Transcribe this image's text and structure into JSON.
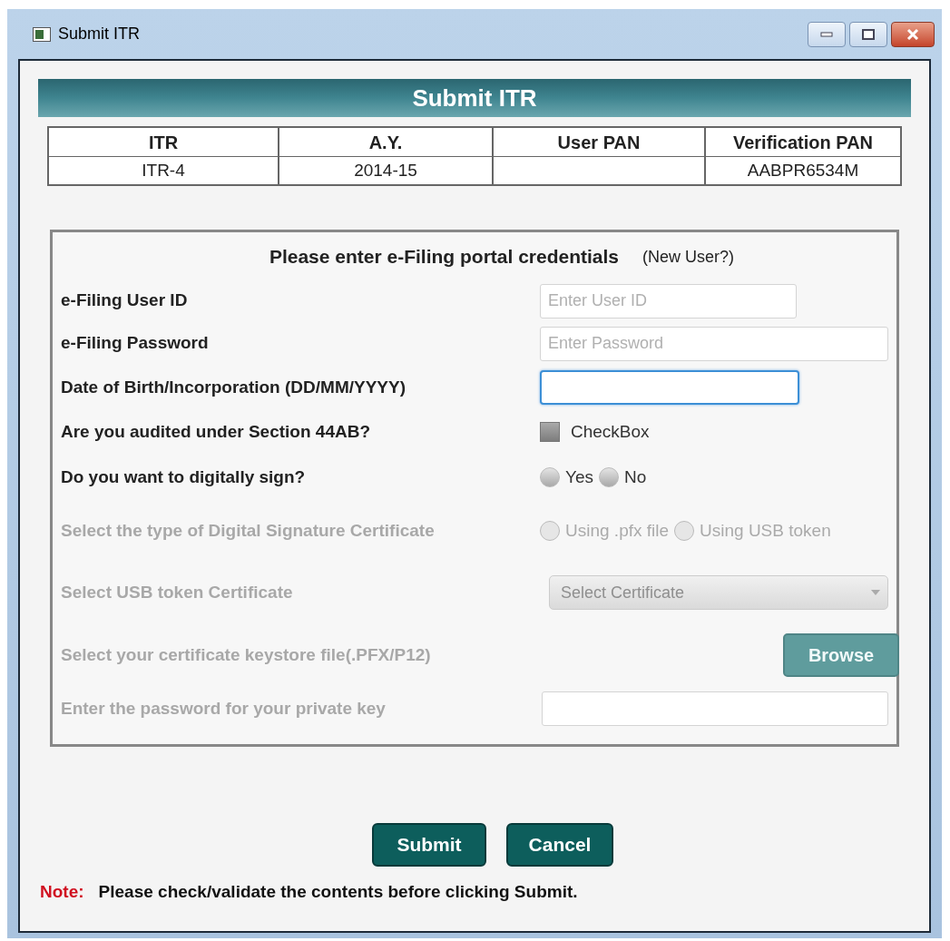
{
  "window": {
    "title": "Submit ITR"
  },
  "banner": "Submit ITR",
  "summary": {
    "columns": [
      "ITR",
      "A.Y.",
      "User PAN",
      "Verification PAN"
    ],
    "row": {
      "itr": "ITR-4",
      "ay": "2014-15",
      "verification_pan": "AABPR6534M"
    }
  },
  "form": {
    "heading": "Please enter e-Filing portal credentials",
    "link": "(New User?)",
    "rows": [
      {
        "kind": "text",
        "label": "e-Filing User ID",
        "placeholder": "Enter User ID",
        "disabled": false,
        "focused": false
      },
      {
        "kind": "text",
        "label": "e-Filing Password",
        "placeholder": "Enter Password",
        "disabled": false,
        "focused": false
      },
      {
        "kind": "text",
        "label": "Date of Birth/Incorporation (DD/MM/YYYY)",
        "disabled": false,
        "focused": true
      },
      {
        "kind": "checkbox",
        "label": "Are you audited under Section 44AB?",
        "option": "CheckBox",
        "checked": false,
        "disabled": false
      },
      {
        "kind": "radio",
        "label": "Do you want to digitally sign?",
        "disabled": false,
        "options": [
          {
            "label": "Yes",
            "selected": false
          },
          {
            "label": "No",
            "selected": false
          }
        ]
      },
      {
        "kind": "radio",
        "label": "Select the type of Digital Signature Certificate",
        "disabled": true,
        "options": [
          {
            "label": "Using .pfx file",
            "selected": false
          },
          {
            "label": "Using USB token",
            "selected": false
          }
        ]
      },
      {
        "kind": "select",
        "label": "Select USB token Certificate",
        "placeholder": "Select Certificate",
        "disabled": true
      },
      {
        "kind": "button",
        "label": "Select your certificate keystore file(.PFX/P12)",
        "button": "Browse",
        "disabled": true
      },
      {
        "kind": "text",
        "label": "Enter the password for your private key",
        "disabled": true,
        "focused": false
      }
    ]
  },
  "buttons": [
    "Submit",
    "Cancel"
  ],
  "note": {
    "label": "Note:",
    "text": "Please check/validate the contents before clicking Submit."
  }
}
